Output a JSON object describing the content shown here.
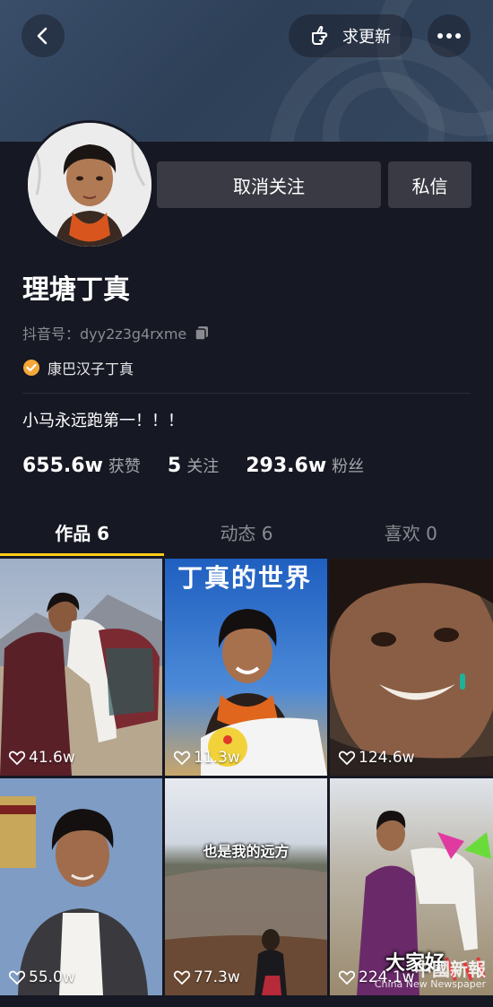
{
  "header": {
    "request_update_label": "求更新"
  },
  "profile": {
    "name": "理塘丁真",
    "id_label": "抖音号：",
    "id_value": "dyy2z3g4rxme",
    "verified_label": "康巴汉子丁真",
    "bio": "小马永远跑第一！！！",
    "unfollow_label": "取消关注",
    "message_label": "私信"
  },
  "stats": [
    {
      "value": "655.6w",
      "label": "获赞"
    },
    {
      "value": "5",
      "label": "关注"
    },
    {
      "value": "293.6w",
      "label": "粉丝"
    }
  ],
  "tabs": [
    {
      "label": "作品 6",
      "active": true
    },
    {
      "label": "动态 6",
      "active": false
    },
    {
      "label": "喜欢 0",
      "active": false
    }
  ],
  "videos": [
    {
      "likes": "41.6w"
    },
    {
      "likes": "11.3w",
      "title": "丁真的世界"
    },
    {
      "likes": "124.6w"
    },
    {
      "likes": "55.0w"
    },
    {
      "likes": "77.3w",
      "title": "也是我的远方"
    },
    {
      "likes": "224.1w",
      "title": "大家好"
    }
  ],
  "watermark": {
    "title": "中國新報",
    "subtitle": "China New Newspaper"
  },
  "colors": {
    "background": "#161823",
    "tab_indicator": "#face15",
    "verified_badge": "#f6a73a"
  }
}
